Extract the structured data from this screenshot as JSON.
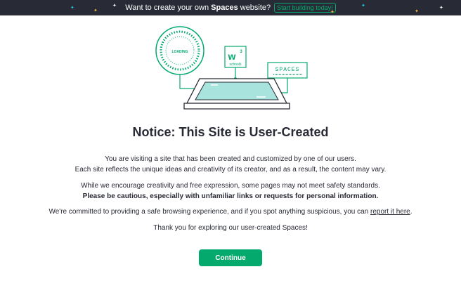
{
  "banner": {
    "message_prefix": "Want to create your own",
    "message_brand": "Spaces",
    "message_suffix": "website?",
    "cta_label": "Start building today!"
  },
  "illustration": {
    "badge_text": "LOADING",
    "w3_letter": "w",
    "w3_super": "3",
    "w3_sub": "schools",
    "spaces_text": "SPACES"
  },
  "notice": {
    "title": "Notice: This Site is User-Created",
    "line1": "You are visiting a site that has been created and customized by one of our users.",
    "line2": "Each site reflects the unique ideas and creativity of its creator, and as a result, the content may vary.",
    "line3": "While we encourage creativity and free expression, some pages may not meet safety standards.",
    "line4_bold": "Please be cautious, especially with unfamiliar links or requests for personal information.",
    "line5_prefix": "We're committed to providing a safe browsing experience, and if you spot anything suspicious, you can",
    "line5_link": "report it here",
    "line5_suffix": ".",
    "line6": "Thank you for exploring our user-created Spaces!"
  },
  "continue_label": "Continue",
  "colors": {
    "accent": "#04aa6d",
    "topbar_bg": "#282a35",
    "text": "#282a35"
  }
}
